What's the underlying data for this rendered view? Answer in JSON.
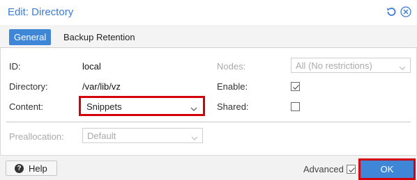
{
  "dialog": {
    "title": "Edit: Directory"
  },
  "tabs": [
    {
      "label": "General",
      "active": true
    },
    {
      "label": "Backup Retention",
      "active": false
    }
  ],
  "form": {
    "id": {
      "label": "ID:",
      "value": "local"
    },
    "directory": {
      "label": "Directory:",
      "value": "/var/lib/vz"
    },
    "content": {
      "label": "Content:",
      "value": "Snippets"
    },
    "nodes": {
      "label": "Nodes:",
      "value": "All (No restrictions)"
    },
    "enable": {
      "label": "Enable:",
      "checked": true
    },
    "shared": {
      "label": "Shared:",
      "checked": false
    },
    "preallocation": {
      "label": "Preallocation:",
      "value": "Default"
    }
  },
  "footer": {
    "help_label": "Help",
    "advanced_label": "Advanced",
    "advanced_checked": true,
    "ok_label": "OK"
  },
  "colors": {
    "accent": "#3f87d6",
    "title": "#3a7bd5",
    "highlight": "#d4000b"
  }
}
